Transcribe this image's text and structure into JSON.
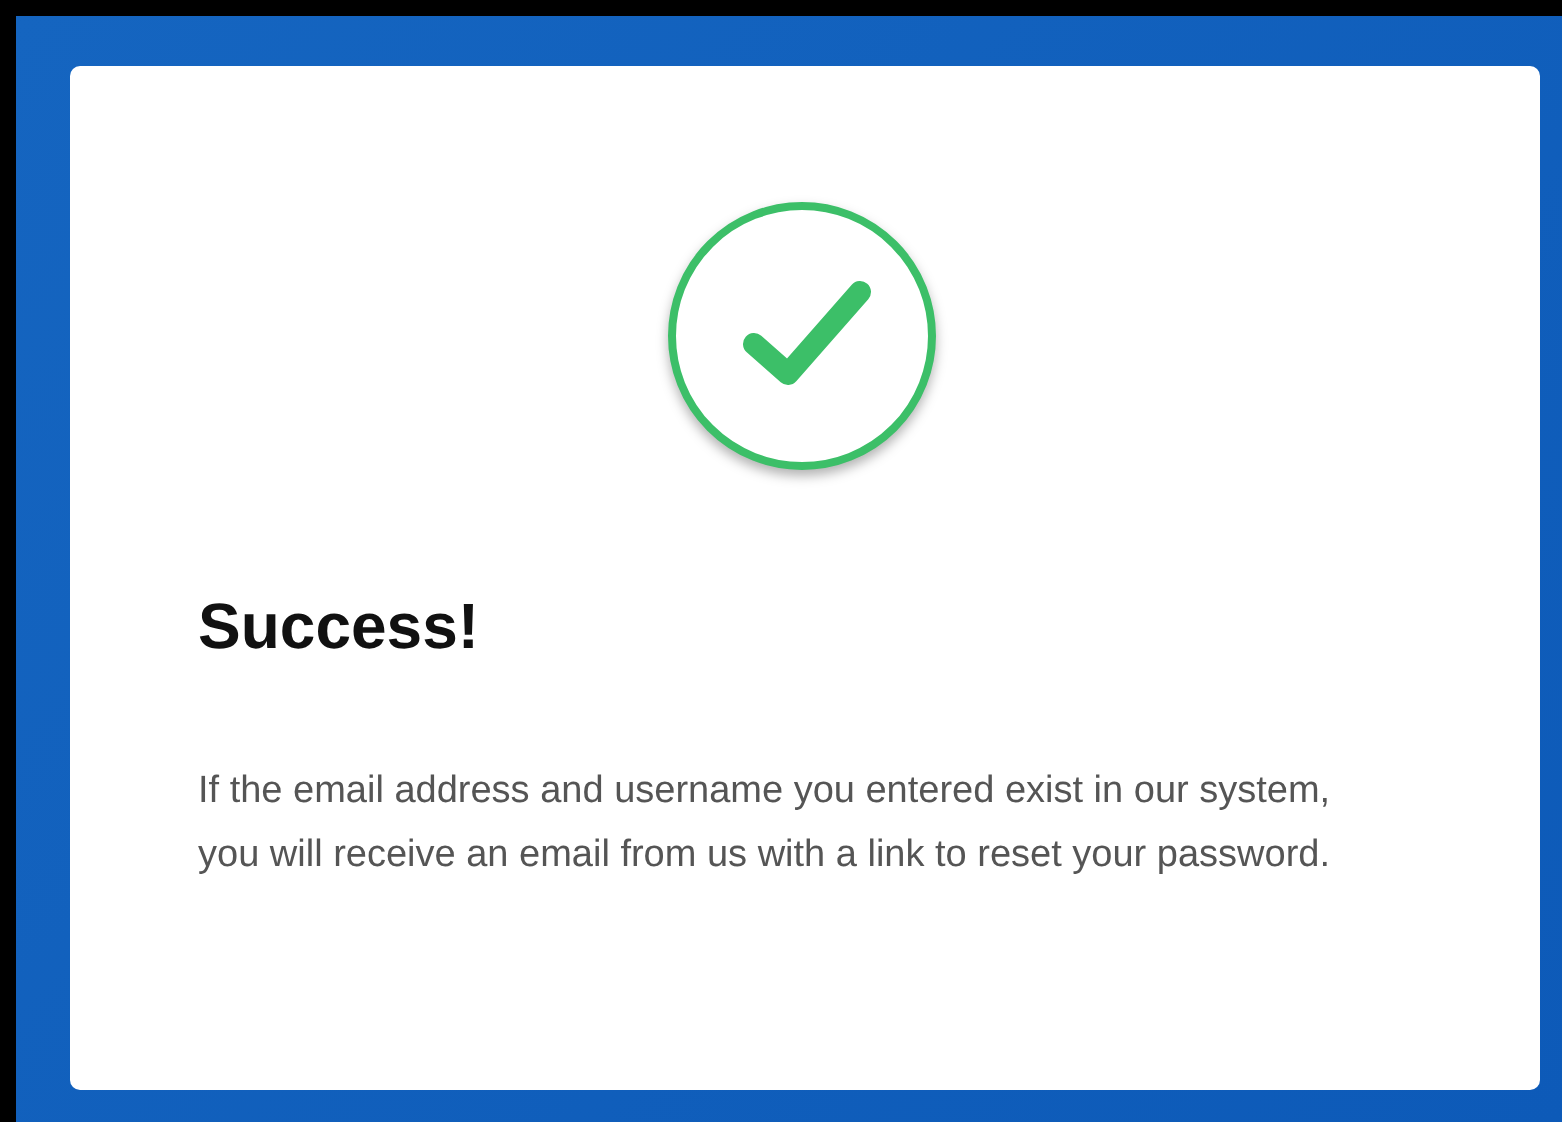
{
  "card": {
    "title": "Success!",
    "message": "If the email address and username you entered exist in our system, you will receive an email from us with a link to reset your password."
  }
}
